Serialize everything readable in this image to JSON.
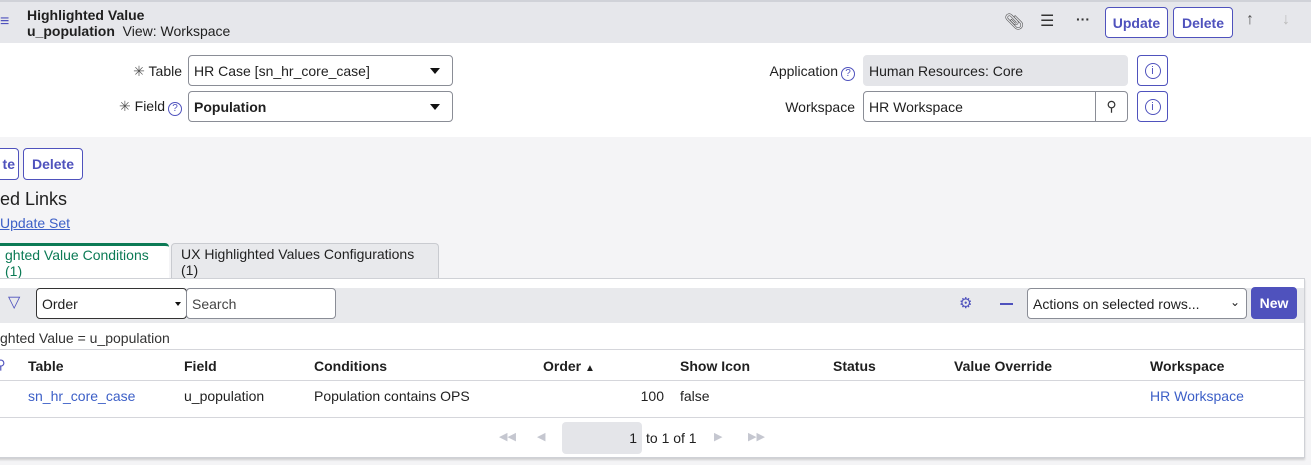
{
  "header": {
    "title": "Highlighted Value",
    "subtitle": "u_population",
    "view": "View: Workspace",
    "update": "Update",
    "delete": "Delete"
  },
  "form": {
    "table_label": "Table",
    "table_value": "HR Case [sn_hr_core_case]",
    "field_label": "Field",
    "field_value": "Population",
    "application_label": "Application",
    "application_value": "Human Resources: Core",
    "workspace_label": "Workspace",
    "workspace_value": "HR Workspace"
  },
  "actions": {
    "update_partial": "te",
    "delete": "Delete"
  },
  "related": {
    "title_partial": "ed Links",
    "link": "Update Set"
  },
  "tabs": [
    {
      "label": "ghted Value Conditions (1)"
    },
    {
      "label": "UX Highlighted Values Configurations (1)"
    }
  ],
  "list": {
    "search_field": "Order",
    "search_placeholder": "Search",
    "actions_select": "Actions on selected rows...",
    "new": "New",
    "breadcrumb": "ghted Value = u_population",
    "columns": [
      "Table",
      "Field",
      "Conditions",
      "Order",
      "Show Icon",
      "Status",
      "Value Override",
      "Workspace"
    ],
    "rows": [
      {
        "table": "sn_hr_core_case",
        "field": "u_population",
        "conditions": "Population contains OPS",
        "order": "100",
        "show_icon": "false",
        "status": "",
        "value_override": "",
        "workspace": "HR Workspace"
      }
    ],
    "pager": {
      "page": "1",
      "range": "to 1 of 1"
    }
  }
}
